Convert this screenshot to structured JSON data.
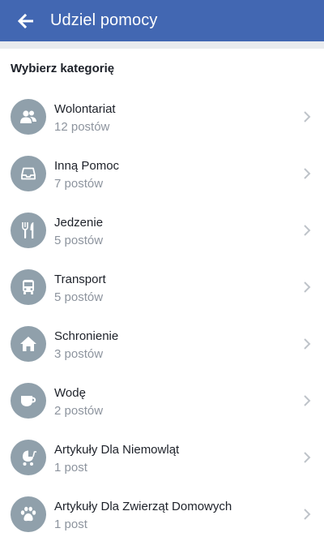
{
  "header": {
    "title": "Udziel pomocy",
    "background_color": "#4267b2",
    "back_icon": "arrow-left-icon"
  },
  "section": {
    "title": "Wybierz kategorię"
  },
  "categories": [
    {
      "label": "Wolontariat",
      "count": "12 postów",
      "icon": "people-icon"
    },
    {
      "label": "Inną Pomoc",
      "count": "7 postów",
      "icon": "inbox-tray-icon"
    },
    {
      "label": "Jedzenie",
      "count": "5 postów",
      "icon": "fork-knife-icon"
    },
    {
      "label": "Transport",
      "count": "5 postów",
      "icon": "bus-icon"
    },
    {
      "label": "Schronienie",
      "count": "3 postów",
      "icon": "house-icon"
    },
    {
      "label": "Wodę",
      "count": "2 postów",
      "icon": "cup-icon"
    },
    {
      "label": "Artykuły Dla Niemowląt",
      "count": "1 post",
      "icon": "stroller-icon"
    },
    {
      "label": "Artykuły Dla Zwierząt Domowych",
      "count": "1 post",
      "icon": "paw-icon"
    }
  ],
  "colors": {
    "icon_circle": "#90a0ab",
    "subtitle": "#8d949e",
    "chevron": "#bec3c9"
  }
}
